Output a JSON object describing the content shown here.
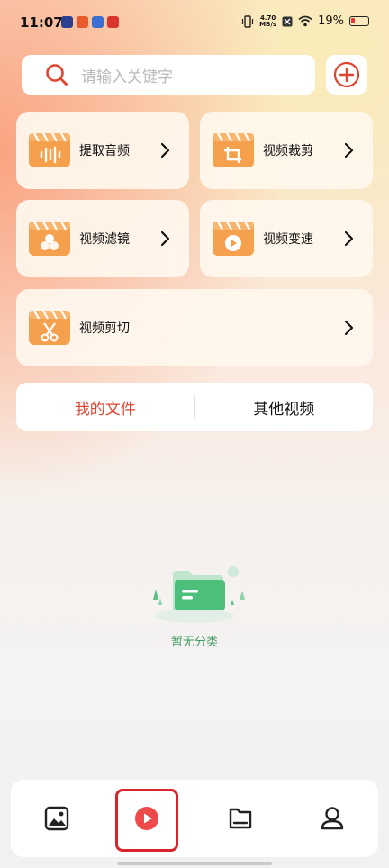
{
  "status_bar": {
    "time": "11:07",
    "net_speed_value": "4.70",
    "net_speed_unit": "MB/s",
    "battery_percent": "19%"
  },
  "search": {
    "placeholder": "请输入关键字"
  },
  "tools": [
    {
      "label": "提取音频",
      "icon": "audio-wave-icon"
    },
    {
      "label": "视频裁剪",
      "icon": "crop-icon"
    },
    {
      "label": "视频滤镜",
      "icon": "filter-icon"
    },
    {
      "label": "视频变速",
      "icon": "speed-icon"
    },
    {
      "label": "视频剪切",
      "icon": "scissors-icon"
    }
  ],
  "tabs": [
    {
      "label": "我的文件",
      "active": true
    },
    {
      "label": "其他视频",
      "active": false
    }
  ],
  "empty_state": {
    "text": "暂无分类"
  },
  "bottom_nav": [
    {
      "icon": "image-icon",
      "active": false
    },
    {
      "icon": "video-play-icon",
      "active": true
    },
    {
      "icon": "folder-icon",
      "active": false
    },
    {
      "icon": "profile-icon",
      "active": false
    }
  ],
  "colors": {
    "accent": "#e0452f",
    "tool_icon": "#f5a04c",
    "empty_state": "#3f9b62",
    "highlight": "#d8252b"
  }
}
